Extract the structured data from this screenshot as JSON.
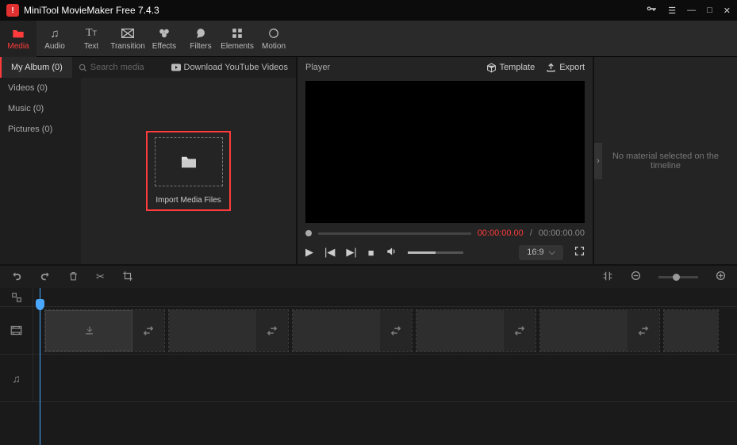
{
  "app": {
    "title": "MiniTool MovieMaker Free 7.4.3"
  },
  "toolbar": {
    "media": "Media",
    "audio": "Audio",
    "text": "Text",
    "transition": "Transition",
    "effects": "Effects",
    "filters": "Filters",
    "elements": "Elements",
    "motion": "Motion"
  },
  "side": {
    "my_album": "My Album (0)",
    "search_placeholder": "Search media",
    "download_yt": "Download YouTube Videos",
    "videos": "Videos (0)",
    "music": "Music (0)",
    "pictures": "Pictures (0)",
    "import_label": "Import Media Files"
  },
  "player": {
    "title": "Player",
    "template": "Template",
    "export": "Export",
    "tc_current": "00:00:00.00",
    "tc_sep": " / ",
    "tc_total": "00:00:00.00",
    "aspect": "16:9"
  },
  "inspector": {
    "empty": "No material selected on the timeline"
  }
}
